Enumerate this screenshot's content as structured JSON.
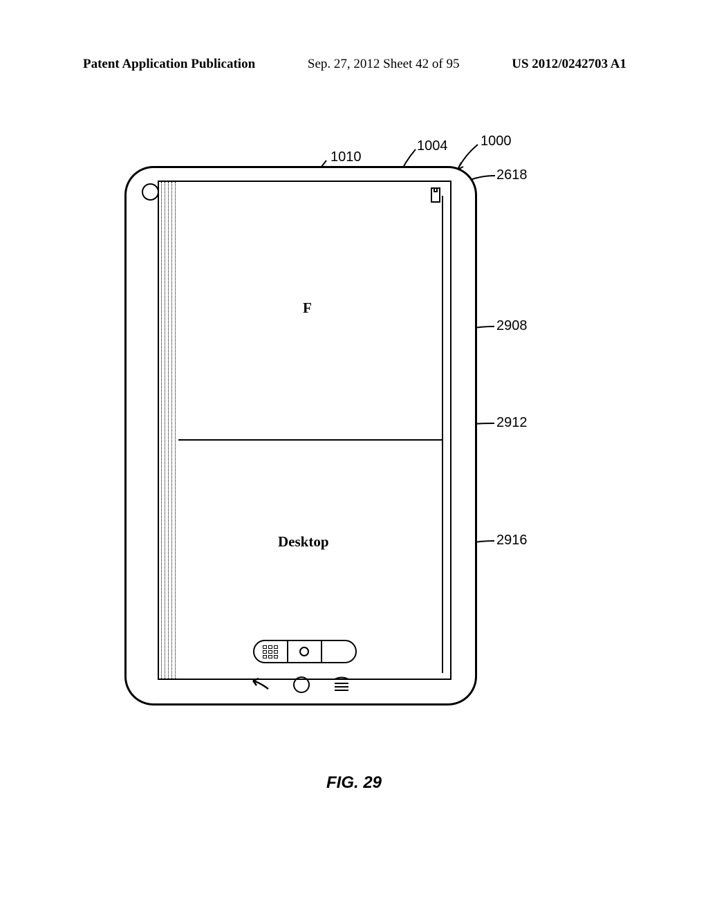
{
  "header": {
    "left": "Patent Application Publication",
    "center": "Sep. 27, 2012  Sheet 42 of 95",
    "right": "US 2012/0242703 A1"
  },
  "figure": {
    "caption": "FIG. 29",
    "area_upper_label": "F",
    "area_lower_label": "Desktop"
  },
  "callouts": {
    "c1000": "1000",
    "c1004": "1004",
    "c1010": "1010",
    "c2618": "2618",
    "c2908": "2908",
    "c2912": "2912",
    "c2916": "2916"
  }
}
